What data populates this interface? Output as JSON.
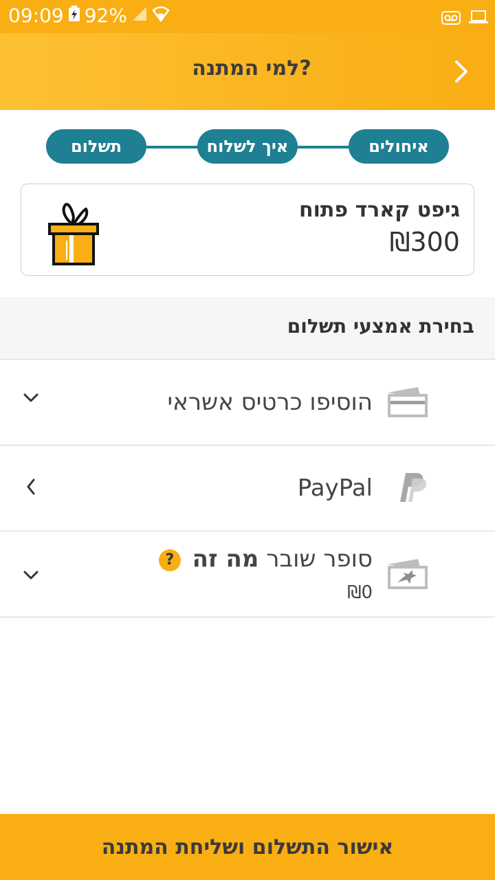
{
  "status_bar": {
    "time": "09:09",
    "battery": "92%"
  },
  "header": {
    "title": "למי המתנה?"
  },
  "steps": [
    {
      "label": "איחולים"
    },
    {
      "label": "איך לשלוח"
    },
    {
      "label": "תשלום"
    }
  ],
  "gift_card": {
    "name": "גיפט קארד פתוח",
    "amount": "₪300"
  },
  "payment_section": {
    "title": "בחירת אמצעי תשלום"
  },
  "payment_methods": [
    {
      "label": "הוסיפו כרטיס אשראי",
      "icon": "credit-card-icon"
    },
    {
      "label": "PayPal",
      "icon": "paypal-icon"
    },
    {
      "label": "סופר שובר",
      "help_text": "מה זה",
      "help_icon": "?",
      "value": "₪0",
      "icon": "voucher-icon"
    }
  ],
  "confirm_button": {
    "label": "אישור התשלום ושליחת המתנה"
  },
  "colors": {
    "accent": "#f9ae13",
    "teal": "#1e8092"
  }
}
